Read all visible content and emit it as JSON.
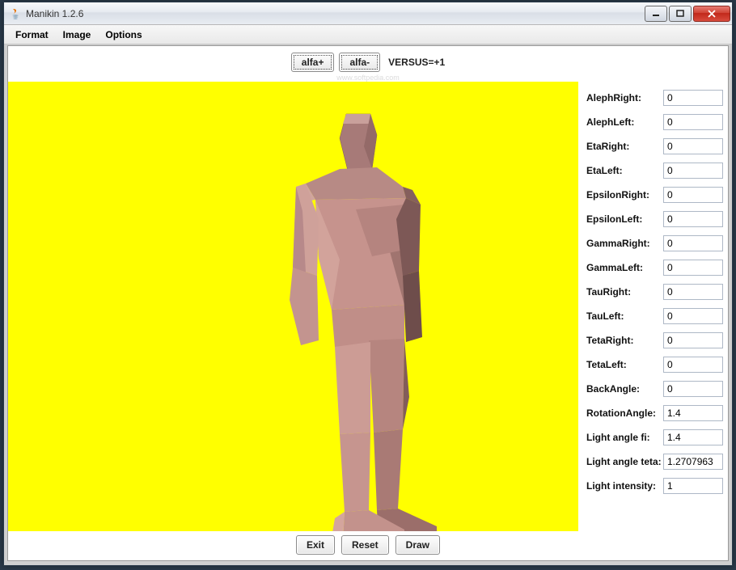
{
  "window": {
    "title": "Manikin 1.2.6"
  },
  "menu": {
    "format": "Format",
    "image": "Image",
    "options": "Options"
  },
  "toolbar": {
    "alfa_plus": "alfa+",
    "alfa_minus": "alfa-",
    "versus": "VERSUS=+1"
  },
  "watermark": "www.softpedia.com",
  "params": [
    {
      "label": "AlephRight:",
      "value": "0"
    },
    {
      "label": "AlephLeft:",
      "value": "0"
    },
    {
      "label": "EtaRight:",
      "value": "0"
    },
    {
      "label": "EtaLeft:",
      "value": "0"
    },
    {
      "label": "EpsilonRight:",
      "value": "0"
    },
    {
      "label": "EpsilonLeft:",
      "value": "0"
    },
    {
      "label": "GammaRight:",
      "value": "0"
    },
    {
      "label": "GammaLeft:",
      "value": "0"
    },
    {
      "label": "TauRight:",
      "value": "0"
    },
    {
      "label": "TauLeft:",
      "value": "0"
    },
    {
      "label": "TetaRight:",
      "value": "0"
    },
    {
      "label": "TetaLeft:",
      "value": "0"
    },
    {
      "label": "BackAngle:",
      "value": "0"
    },
    {
      "label": "RotationAngle:",
      "value": "1.4"
    },
    {
      "label": "Light angle fi:",
      "value": "1.4"
    },
    {
      "label": "Light angle teta:",
      "value": "1.2707963"
    },
    {
      "label": "Light intensity:",
      "value": "1"
    }
  ],
  "buttons": {
    "exit": "Exit",
    "reset": "Reset",
    "draw": "Draw"
  }
}
